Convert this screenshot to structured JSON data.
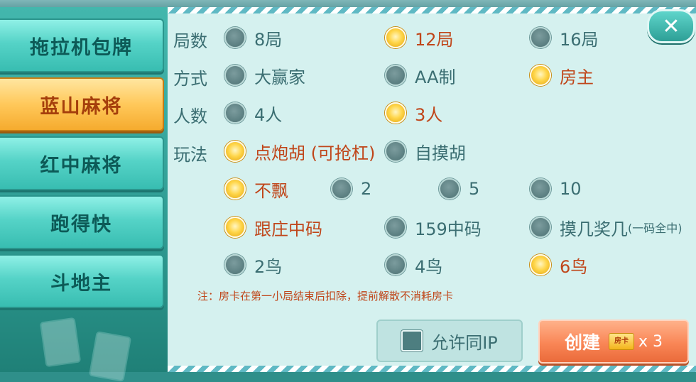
{
  "sidebar": {
    "tabs": [
      {
        "label": "拖拉机包牌",
        "active": false
      },
      {
        "label": "蓝山麻将",
        "active": true
      },
      {
        "label": "红中麻将",
        "active": false
      },
      {
        "label": "跑得快",
        "active": false
      },
      {
        "label": "斗地主",
        "active": false
      }
    ]
  },
  "rows": {
    "rounds": {
      "label": "局数",
      "options": [
        "8局",
        "12局",
        "16局"
      ],
      "selected": "12局"
    },
    "mode": {
      "label": "方式",
      "options": [
        "大赢家",
        "AA制",
        "房主"
      ],
      "selected": "房主"
    },
    "players": {
      "label": "人数",
      "options": [
        "4人",
        "3人"
      ],
      "selected": "3人"
    },
    "play": {
      "label": "玩法",
      "options": [
        "点炮胡 (可抢杠)",
        "自摸胡"
      ],
      "selected": "点炮胡 (可抢杠)"
    },
    "piao": {
      "options": [
        "不飘",
        "2",
        "5",
        "10"
      ],
      "selected": "不飘"
    },
    "code": {
      "options": [
        "跟庄中码",
        "159中码",
        "摸几奖几"
      ],
      "extra": "(一码全中)",
      "selected": "跟庄中码"
    },
    "birds": {
      "options": [
        "2鸟",
        "4鸟",
        "6鸟"
      ],
      "selected": "6鸟"
    }
  },
  "note": "注：房卡在第一小局结束后扣除，提前解散不消耗房卡",
  "ip_button": {
    "label": "允许同IP"
  },
  "create_button": {
    "label": "创建",
    "card_label": "房卡",
    "cost": "x 3"
  },
  "close_button": {
    "glyph": "✕"
  },
  "colors": {
    "selected_text": "#c0461a",
    "normal_text": "#3b6e72",
    "active_tab": "#ffc85a"
  }
}
